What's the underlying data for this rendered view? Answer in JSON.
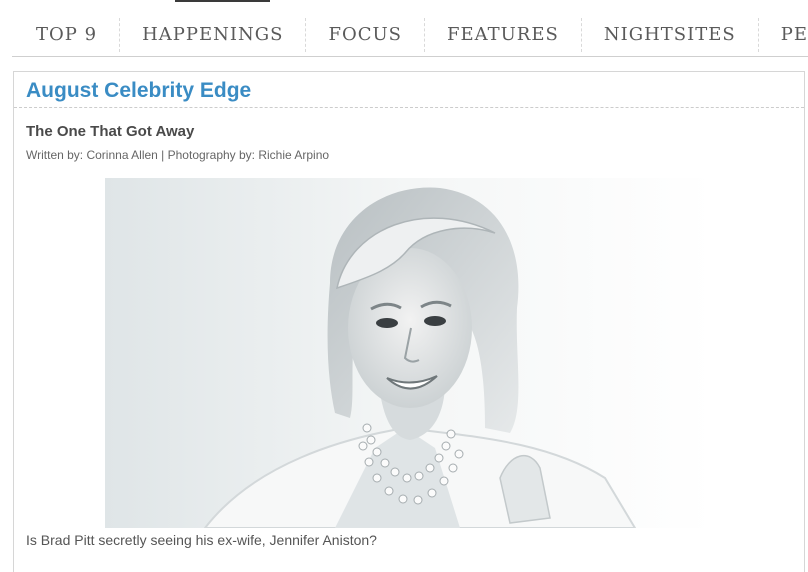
{
  "nav": {
    "items": [
      "TOP 9",
      "HAPPENINGS",
      "FOCUS",
      "FEATURES",
      "NIGHTSITES",
      "PE"
    ]
  },
  "section": {
    "title": "August Celebrity Edge"
  },
  "article": {
    "title": "The One That Got Away",
    "byline": "Written by: Corinna Allen | Photography by: Richie Arpino",
    "caption": "Is Brad Pitt secretly seeing his ex-wife, Jennifer Aniston?"
  }
}
